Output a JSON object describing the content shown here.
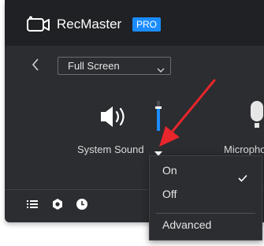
{
  "app": {
    "name": "RecMaster",
    "badge": "PRO"
  },
  "capture": {
    "mode": "Full Screen"
  },
  "audio": {
    "system_sound_label": "System Sound",
    "microphone_label": "Microphone",
    "system_volume": 0.8
  },
  "menu": {
    "items": [
      {
        "label": "On",
        "checked": true
      },
      {
        "label": "Off",
        "checked": false
      },
      {
        "label": "Advanced",
        "checked": false
      }
    ]
  },
  "colors": {
    "accent": "#1a8cff",
    "annotation_arrow": "#e8262b",
    "panel": "#2b2d31",
    "titlebar": "#202124"
  },
  "icons": [
    "recmaster-logo-icon",
    "back-arrow-icon",
    "chevron-down-icon",
    "speaker-icon",
    "microphone-icon",
    "dropdown-triangle-icon",
    "list-icon",
    "settings-icon",
    "clock-icon",
    "checkmark-icon"
  ]
}
